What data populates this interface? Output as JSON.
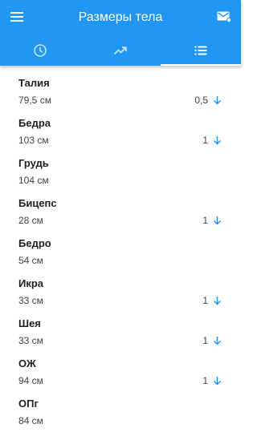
{
  "header": {
    "title": "Размеры тела",
    "accent_color": "#2196f3",
    "menu_icon": "hamburger-menu-icon",
    "mail_icon": "mail-icon"
  },
  "tabs": [
    {
      "icon": "clock-icon",
      "selected": false
    },
    {
      "icon": "trending-up-icon",
      "selected": false
    },
    {
      "icon": "list-icon",
      "selected": true
    }
  ],
  "measurements": [
    {
      "name": "Талия",
      "value": "79,5 см",
      "change": "0,5",
      "direction": "down"
    },
    {
      "name": "Бедра",
      "value": "103 см",
      "change": "1",
      "direction": "down"
    },
    {
      "name": "Грудь",
      "value": "104 см",
      "change": "",
      "direction": ""
    },
    {
      "name": "Бицепс",
      "value": "28 см",
      "change": "1",
      "direction": "down"
    },
    {
      "name": "Бедро",
      "value": "54 см",
      "change": "",
      "direction": ""
    },
    {
      "name": "Икра",
      "value": "33 см",
      "change": "1",
      "direction": "down"
    },
    {
      "name": "Шея",
      "value": "33 см",
      "change": "1",
      "direction": "down"
    },
    {
      "name": "ОЖ",
      "value": "94 см",
      "change": "1",
      "direction": "down"
    },
    {
      "name": "ОПг",
      "value": "84 см",
      "change": "",
      "direction": ""
    }
  ]
}
